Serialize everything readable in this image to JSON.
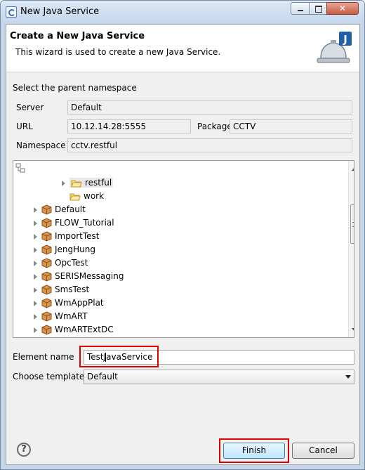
{
  "window": {
    "title": "New Java Service",
    "close_glyph": "✕"
  },
  "header": {
    "title": "Create a New Java Service",
    "description": "This wizard is used to create a new Java Service.",
    "logo_letter": "J"
  },
  "form": {
    "parent_label": "Select the parent namespace",
    "server_label": "Server",
    "server_value": "Default",
    "url_label": "URL",
    "url_value": "10.12.14.28:5555",
    "package_label": "Package",
    "package_value": "CCTV",
    "namespace_label": "Namespace",
    "namespace_value": "cctv.restful"
  },
  "tree": {
    "folders": [
      "restful",
      "work"
    ],
    "packages": [
      "Default",
      "FLOW_Tutorial",
      "ImportTest",
      "JengHung",
      "OpcTest",
      "SERISMessaging",
      "SmsTest",
      "WmAppPlat",
      "WmART",
      "WmARTExtDC"
    ]
  },
  "element": {
    "label": "Element name",
    "value_before_caret": "TestJ",
    "value_after_caret": "avaService"
  },
  "template": {
    "label": "Choose template",
    "value": "Default"
  },
  "buttons": {
    "help": "?",
    "finish": "Finish",
    "cancel": "Cancel"
  }
}
